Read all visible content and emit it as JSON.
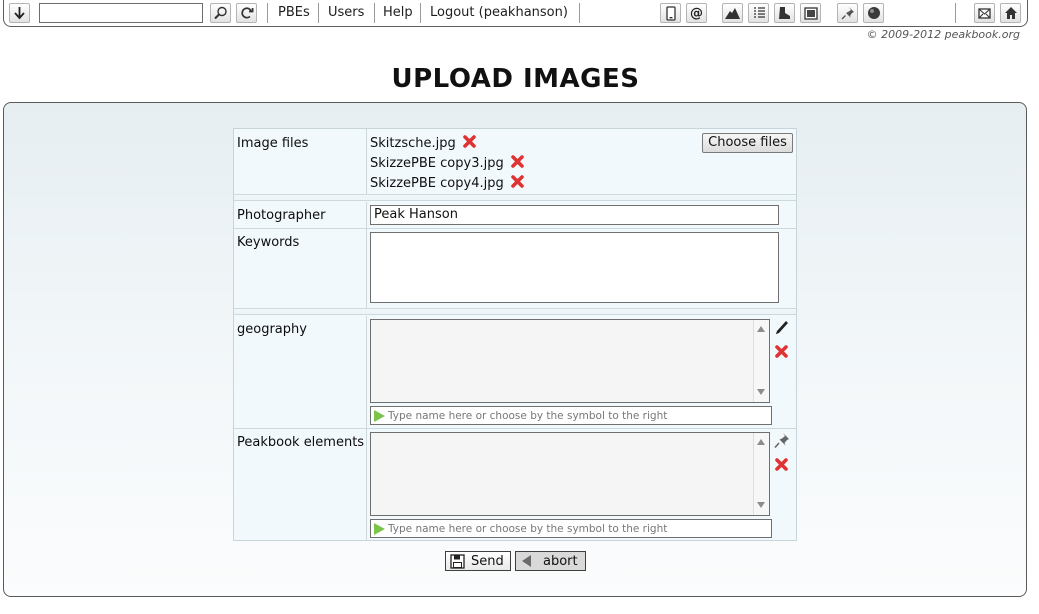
{
  "toolbar": {
    "search_value": "",
    "nav": [
      "PBEs",
      "Users",
      "Help",
      "Logout (peakhanson)"
    ],
    "icons": [
      "download-arrow-icon",
      "search-icon",
      "refresh-icon",
      "phone-icon",
      "at-sign-icon",
      "mountain-icon",
      "list-icon",
      "boot-icon",
      "image-icon",
      "pin-icon",
      "globe-icon",
      "mail-icon",
      "home-icon"
    ]
  },
  "copyright": "© 2009-2012 peakbook.org",
  "page_title": "UPLOAD IMAGES",
  "form": {
    "image_files_label": "Image files",
    "files": [
      "Skitzsche.jpg",
      "SkizzePBE copy3.jpg",
      "SkizzePBE copy4.jpg"
    ],
    "choose_files_label": "Choose files",
    "photographer_label": "Photographer",
    "photographer_value": "Peak Hanson",
    "keywords_label": "Keywords",
    "keywords_value": "",
    "geography_label": "geography",
    "peakbook_elements_label": "Peakbook elements",
    "type_placeholder": "Type name here or choose by the symbol to the right"
  },
  "actions": {
    "send_label": "Send",
    "abort_label": "abort"
  },
  "colors": {
    "delete_red": "#e03434",
    "play_green": "#7cc34a",
    "panel_top": "#e6eef2"
  }
}
